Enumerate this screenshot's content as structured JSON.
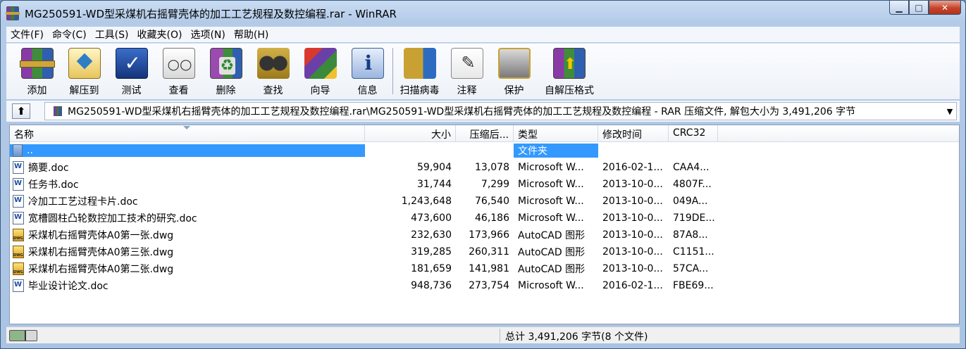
{
  "window": {
    "title": "MG250591-WD型采煤机右摇臂壳体的加工工艺规程及数控编程.rar - WinRAR",
    "minimize": "▁",
    "maximize": "□",
    "close": "✕"
  },
  "menu": [
    "文件(F)",
    "命令(C)",
    "工具(S)",
    "收藏夹(O)",
    "选项(N)",
    "帮助(H)"
  ],
  "toolbar": {
    "add": "添加",
    "extract": "解压到",
    "test": "测试",
    "view": "查看",
    "delete": "删除",
    "find": "查找",
    "wizard": "向导",
    "info": "信息",
    "virus": "扫描病毒",
    "comment": "注释",
    "protect": "保护",
    "sfx": "自解压格式"
  },
  "address": {
    "up": "⬆",
    "path": "MG250591-WD型采煤机右摇臂壳体的加工工艺规程及数控编程.rar\\MG250591-WD型采煤机右摇臂壳体的加工工艺规程及数控编程 - RAR 压缩文件, 解包大小为 3,491,206 字节",
    "dropdown": "▼"
  },
  "columns": {
    "name": "名称",
    "size": "大小",
    "packed": "压缩后...",
    "type": "类型",
    "modified": "修改时间",
    "crc": "CRC32"
  },
  "files": [
    {
      "icon": "folder",
      "name": "..",
      "size": "",
      "packed": "",
      "type": "文件夹",
      "modified": "",
      "crc": ""
    },
    {
      "icon": "doc",
      "name": "摘要.doc",
      "size": "59,904",
      "packed": "13,078",
      "type": "Microsoft W...",
      "modified": "2016-02-1...",
      "crc": "CAA4..."
    },
    {
      "icon": "doc",
      "name": "任务书.doc",
      "size": "31,744",
      "packed": "7,299",
      "type": "Microsoft W...",
      "modified": "2013-10-0...",
      "crc": "4807F..."
    },
    {
      "icon": "doc",
      "name": "冷加工工艺过程卡片.doc",
      "size": "1,243,648",
      "packed": "76,540",
      "type": "Microsoft W...",
      "modified": "2013-10-0...",
      "crc": "049A..."
    },
    {
      "icon": "doc",
      "name": "宽槽圆柱凸轮数控加工技术的研究.doc",
      "size": "473,600",
      "packed": "46,186",
      "type": "Microsoft W...",
      "modified": "2013-10-0...",
      "crc": "719DE..."
    },
    {
      "icon": "dwg",
      "name": "采煤机右摇臂壳体A0第一张.dwg",
      "size": "232,630",
      "packed": "173,966",
      "type": "AutoCAD 图形",
      "modified": "2013-10-0...",
      "crc": "87A8..."
    },
    {
      "icon": "dwg",
      "name": "采煤机右摇臂壳体A0第三张.dwg",
      "size": "319,285",
      "packed": "260,311",
      "type": "AutoCAD 图形",
      "modified": "2013-10-0...",
      "crc": "C1151..."
    },
    {
      "icon": "dwg",
      "name": "采煤机右摇臂壳体A0第二张.dwg",
      "size": "181,659",
      "packed": "141,981",
      "type": "AutoCAD 图形",
      "modified": "2013-10-0...",
      "crc": "57CA..."
    },
    {
      "icon": "doc",
      "name": "毕业设计论文.doc",
      "size": "948,736",
      "packed": "273,754",
      "type": "Microsoft W...",
      "modified": "2016-02-1...",
      "crc": "FBE69..."
    }
  ],
  "status": {
    "text": "总计 3,491,206 字节(8 个文件)"
  }
}
